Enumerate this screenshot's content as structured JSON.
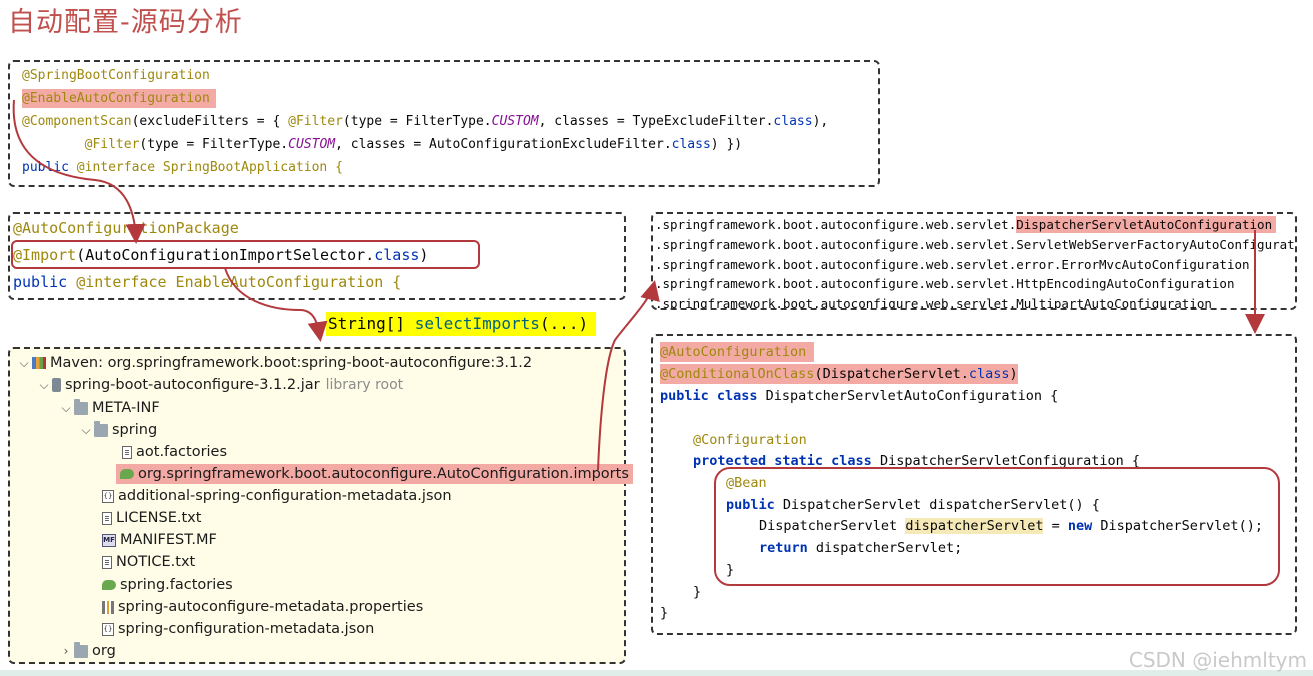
{
  "title": "自动配置-源码分析",
  "box1": {
    "l1": "@SpringBootConfiguration",
    "l2": "@EnableAutoConfiguration",
    "l3_ann": "@ComponentScan",
    "l3_a": "(excludeFilters = { ",
    "l3_b": "@Filter",
    "l3_c": "(type = FilterType.",
    "l3_d": "CUSTOM",
    "l3_e": ", classes = TypeExcludeFilter.",
    "l3_f": "class",
    "l3_g": "),",
    "l4_pad": "        ",
    "l4_b": "@Filter",
    "l4_c": "(type = FilterType.",
    "l4_d": "CUSTOM",
    "l4_e": ", classes = AutoConfigurationExcludeFilter.",
    "l4_f": "class",
    "l4_g": ") })",
    "l5_kw": "public",
    "l5_ann": " @interface",
    "l5_name": " SpringBootApplication {"
  },
  "box2": {
    "l1": "@AutoConfigurationPackage",
    "l2_ann": "@Import",
    "l2_a": "(AutoConfigurationImportSelector.",
    "l2_kw": "class",
    "l2_b": ")",
    "l3_kw": "public",
    "l3_ann": " @interface",
    "l3_name": " EnableAutoConfiguration {"
  },
  "callout": {
    "type": "String[] ",
    "fn": "selectImports",
    "args": "(...)"
  },
  "tree": {
    "maven": "Maven: org.springframework.boot:spring-boot-autoconfigure:3.1.2",
    "jar": "spring-boot-autoconfigure-3.1.2.jar",
    "jar_hint": "library root",
    "meta_inf": "META-INF",
    "spring": "spring",
    "aot": "aot.factories",
    "imports": "org.springframework.boot.autoconfigure.AutoConfiguration.imports",
    "additional": "additional-spring-configuration-metadata.json",
    "license": "LICENSE.txt",
    "manifest": "MANIFEST.MF",
    "notice": "NOTICE.txt",
    "factories": "spring.factories",
    "props": "spring-autoconfigure-metadata.properties",
    "confjson": "spring-configuration-metadata.json",
    "org": "org",
    "mf_icon_text": "MF",
    "json_icon_text": "{}"
  },
  "box3": {
    "prefix": ".springframework.boot.autoconfigure.web.servlet.",
    "l1_hl": "DispatcherServletAutoConfiguration",
    "l2": "ServletWebServerFactoryAutoConfiguration",
    "l3": "error.ErrorMvcAutoConfiguration",
    "l4": "HttpEncodingAutoConfiguration",
    "l5": "MultipartAutoConfiguration"
  },
  "box4": {
    "l1": "@AutoConfiguration",
    "l2_ann": "@ConditionalOnClass",
    "l2_a": "(DispatcherServlet.",
    "l2_kw": "class",
    "l2_b": ")",
    "l3_kw": "public class",
    "l3_name": " DispatcherServletAutoConfiguration {",
    "l4": "@Configuration",
    "l5_kw": "protected static class",
    "l5_name": " DispatcherServletConfiguration {",
    "l6": "@Bean",
    "l7_kw": "public",
    "l7_name": " DispatcherServlet dispatcherServlet() {",
    "l8_a": "DispatcherServlet ",
    "l8_hl": "dispatcherServlet",
    "l8_b": " = ",
    "l8_kw": "new",
    "l8_c": " DispatcherServlet();",
    "l9_kw": "return",
    "l9_a": " dispatcherServlet;",
    "l10": "}",
    "l11": "}",
    "l12": "}"
  },
  "watermark": "CSDN @iehmltym",
  "colors": {
    "annotation": "#9e880d",
    "keyword": "#0033b3",
    "highlight_red": "#f4aaa4",
    "callout_bg": "#ffff00",
    "arrow": "#b3393d",
    "title": "#c0504d"
  }
}
